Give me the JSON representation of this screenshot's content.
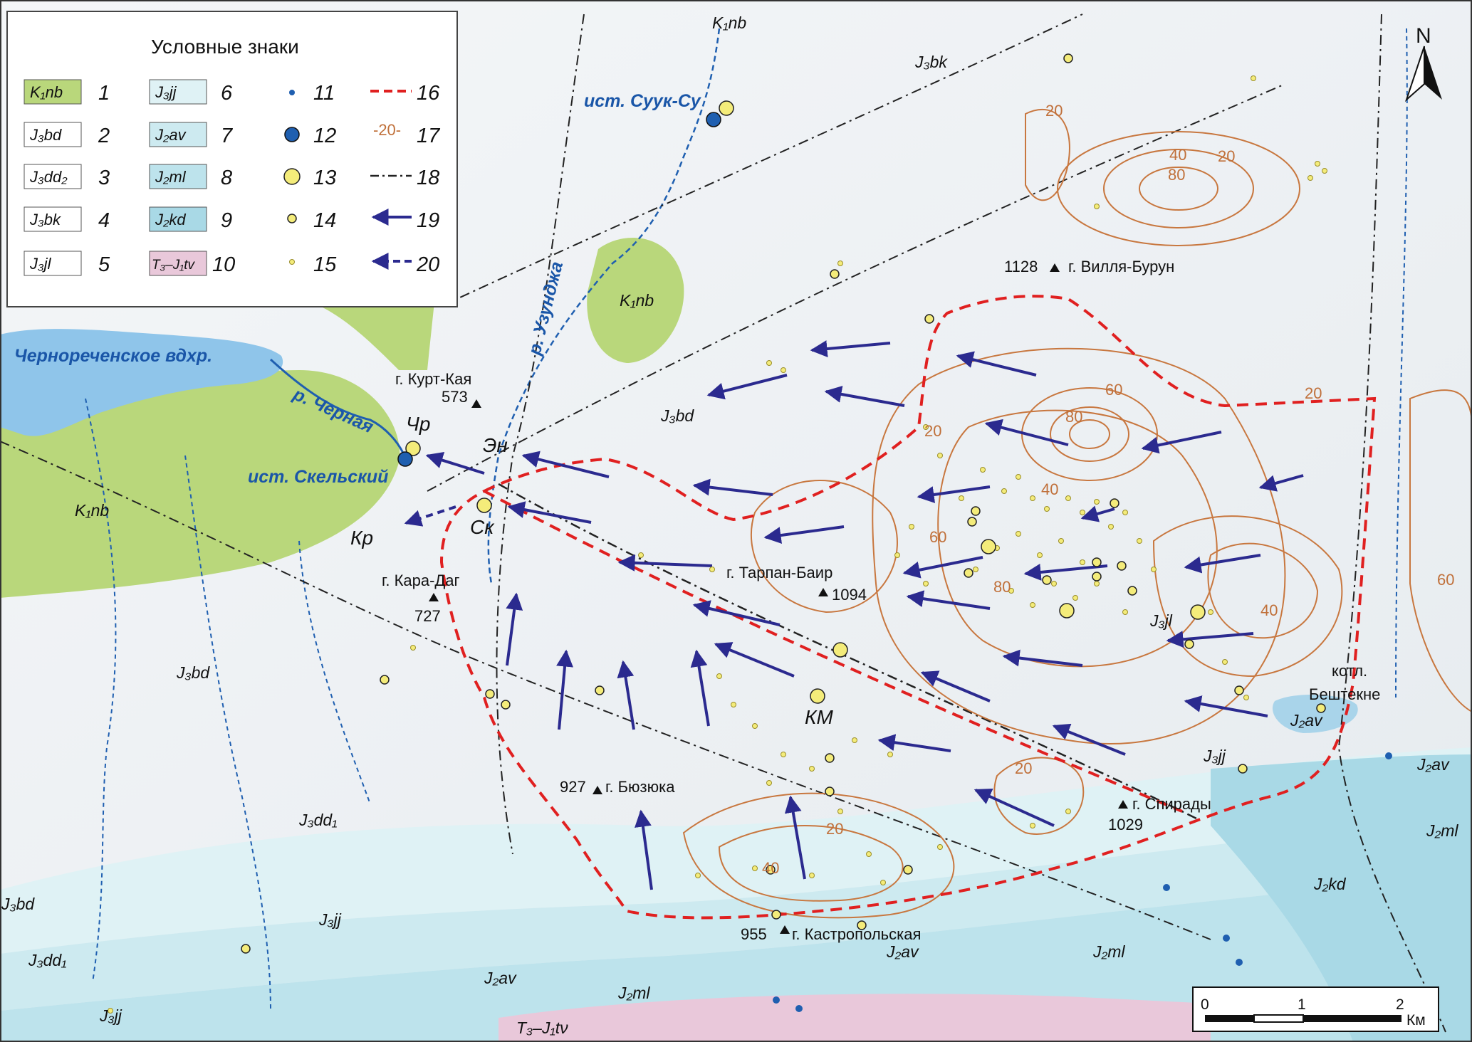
{
  "legend": {
    "title": "Условные знаки",
    "items": [
      {
        "num": "1",
        "kind": "box",
        "code": "K₁nb",
        "fill": "#b9d77b"
      },
      {
        "num": "2",
        "kind": "box",
        "code": "J₃bd",
        "fill": "#ffffff"
      },
      {
        "num": "3",
        "kind": "box",
        "code": "J₃dd₂",
        "fill": "#ffffff"
      },
      {
        "num": "4",
        "kind": "box",
        "code": "J₃bk",
        "fill": "#ffffff"
      },
      {
        "num": "5",
        "kind": "box",
        "code": "J₃jl",
        "fill": "#ffffff"
      },
      {
        "num": "6",
        "kind": "box",
        "code": "J₃jj",
        "fill": "#dff2f5"
      },
      {
        "num": "7",
        "kind": "box",
        "code": "J₂av",
        "fill": "#cdeaf0"
      },
      {
        "num": "8",
        "kind": "box",
        "code": "J₂ml",
        "fill": "#bde3ec"
      },
      {
        "num": "9",
        "kind": "box",
        "code": "J₂kd",
        "fill": "#a9d9e6"
      },
      {
        "num": "10",
        "kind": "box",
        "code": "T₃–J₁tv",
        "fill": "#e9c8da"
      },
      {
        "num": "11",
        "kind": "dot-small-blue"
      },
      {
        "num": "12",
        "kind": "dot-large-blue"
      },
      {
        "num": "13",
        "kind": "circle-large-yellow"
      },
      {
        "num": "14",
        "kind": "circle-medium-yellow"
      },
      {
        "num": "15",
        "kind": "circle-small-yellow"
      },
      {
        "num": "16",
        "kind": "line-dashed-red"
      },
      {
        "num": "17",
        "kind": "line-isoline",
        "label": "-20-"
      },
      {
        "num": "18",
        "kind": "line-dashdot"
      },
      {
        "num": "19",
        "kind": "arrow-solid"
      },
      {
        "num": "20",
        "kind": "arrow-dashed"
      }
    ]
  },
  "north": "N",
  "scalebar": {
    "ticks": [
      "0",
      "1",
      "2"
    ],
    "unit": "Км"
  },
  "water": {
    "reservoir": "Чернореченское вдхр.",
    "river_chernaya": "р. Черная",
    "river_uzundzha": "р. Узунджа",
    "spring_suuk": "ист. Суук-Су",
    "spring_skelsky": "ист. Скельский"
  },
  "peaks": {
    "kurt_kaya_name": "г. Курт-Кая",
    "kurt_kaya_elev": "573",
    "kara_dag_name": "г. Кара-Даг",
    "kara_dag_elev": "727",
    "tarpan": "г. Тарпан-Баир",
    "tarpan_elev": "1094",
    "villya_elev": "1128",
    "villya": "г. Вилля-Бурун",
    "byuzyuka_elev": "927",
    "byuzyuka": "г. Бюзюка",
    "spiradi": "г. Спирады",
    "spiradi_elev": "1029",
    "kastro_elev": "955",
    "kastro": "г. Кастропольская",
    "beshtekne_1": "котл.",
    "beshtekne_2": "Бештекне"
  },
  "points": {
    "chr": "Чр",
    "en": "Эн",
    "sk": "Ск",
    "kr": "Кр",
    "km": "КМ"
  },
  "map_labels": {
    "k1nb": "K₁nb",
    "j3bk": "J₃bk",
    "j3bd": "J₃bd",
    "j3jl": "J₃jl",
    "j3jj": "J₃jj",
    "j3dd1": "J₃dd₁",
    "j2av": "J₂av",
    "j2ml": "J₂ml",
    "j2kd": "J₂kd",
    "t3j1tv": "T₃–J₁tν"
  },
  "isolines": [
    "20",
    "40",
    "60",
    "80"
  ],
  "colors": {
    "k1nb": "#b9d77b",
    "water": "#8fc5ea",
    "river": "#1f5fb0",
    "boundary": "#e02020",
    "isoline": "#c8773f",
    "arrow": "#2b2a8f",
    "yellow": "#f4ec7a"
  }
}
